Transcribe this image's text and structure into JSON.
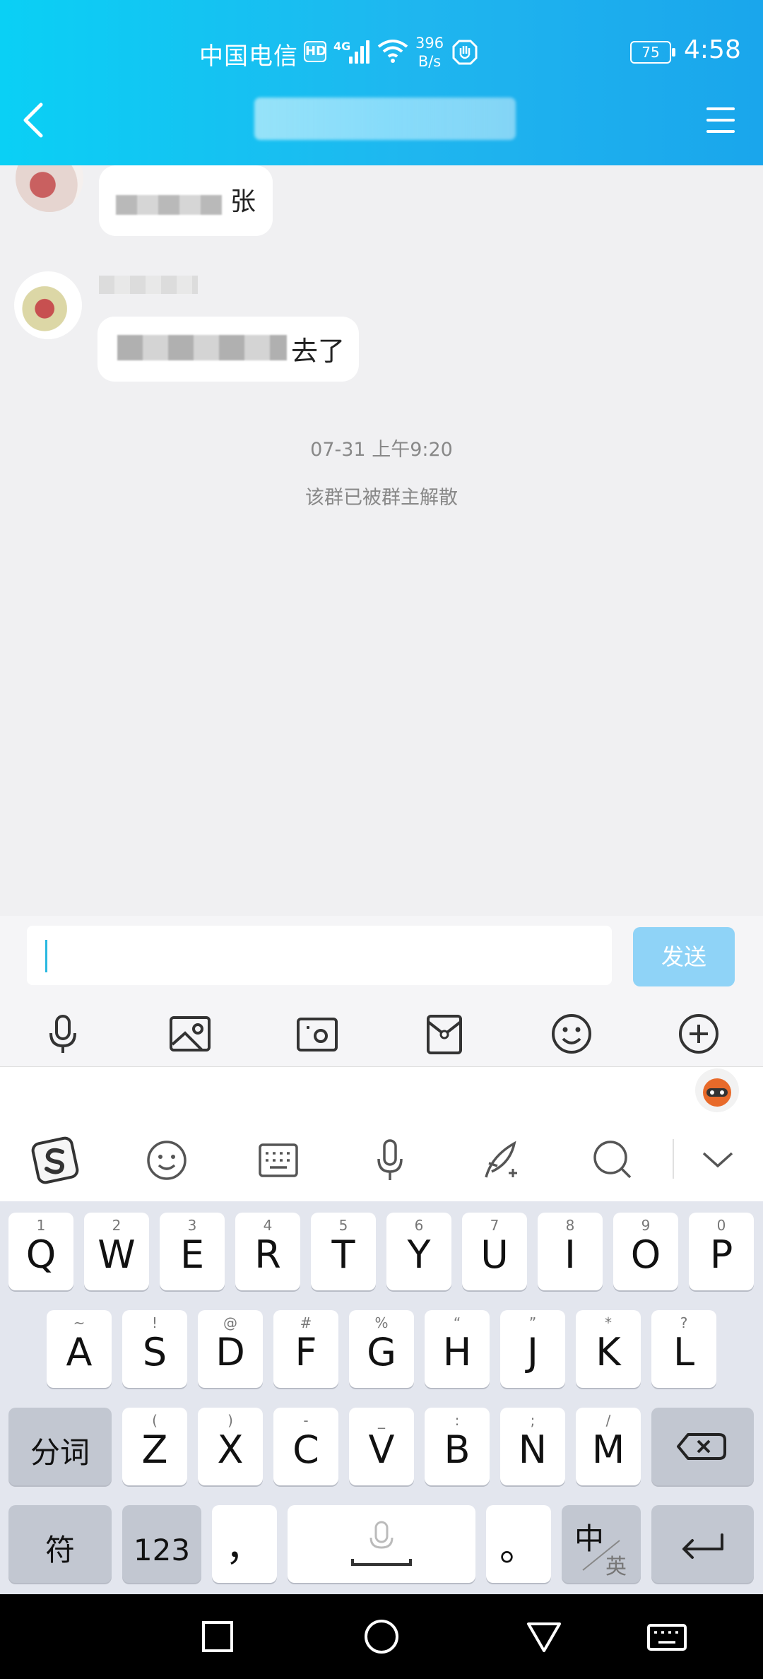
{
  "status_bar": {
    "carrier": "中国电信",
    "hd": "HD",
    "network": "4G",
    "speed_value": "396",
    "speed_unit": "B/s",
    "battery": "75",
    "time": "4:58"
  },
  "header": {
    "title": "(blurred)"
  },
  "chat": {
    "messages": [
      {
        "text": "(blurred)",
        "visible_char": "张"
      },
      {
        "sender": "(blurred)",
        "text": "(blurred)",
        "visible_char": "去了"
      }
    ],
    "timestamp": "07-31 上午9:20",
    "system_message": "该群已被群主解散"
  },
  "composer": {
    "input_value": "",
    "send_label": "发送",
    "tools": [
      "mic-icon",
      "image-icon",
      "camera-icon",
      "red-packet-icon",
      "emoji-icon",
      "plus-icon"
    ]
  },
  "ime_toolbar": {
    "icons": [
      "sogou-logo-icon",
      "emoji-icon",
      "keyboard-icon",
      "mic-icon",
      "handwriting-icon",
      "search-icon",
      "collapse-icon"
    ]
  },
  "keyboard": {
    "row1": [
      {
        "main": "Q",
        "sub": "1"
      },
      {
        "main": "W",
        "sub": "2"
      },
      {
        "main": "E",
        "sub": "3"
      },
      {
        "main": "R",
        "sub": "4"
      },
      {
        "main": "T",
        "sub": "5"
      },
      {
        "main": "Y",
        "sub": "6"
      },
      {
        "main": "U",
        "sub": "7"
      },
      {
        "main": "I",
        "sub": "8"
      },
      {
        "main": "O",
        "sub": "9"
      },
      {
        "main": "P",
        "sub": "0"
      }
    ],
    "row2": [
      {
        "main": "A",
        "sub": "~"
      },
      {
        "main": "S",
        "sub": "!"
      },
      {
        "main": "D",
        "sub": "@"
      },
      {
        "main": "F",
        "sub": "#"
      },
      {
        "main": "G",
        "sub": "%"
      },
      {
        "main": "H",
        "sub": "“"
      },
      {
        "main": "J",
        "sub": "”"
      },
      {
        "main": "K",
        "sub": "*"
      },
      {
        "main": "L",
        "sub": "?"
      }
    ],
    "row3": [
      {
        "main": "Z",
        "sub": "("
      },
      {
        "main": "X",
        "sub": ")"
      },
      {
        "main": "C",
        "sub": "-"
      },
      {
        "main": "V",
        "sub": "_"
      },
      {
        "main": "B",
        "sub": ":"
      },
      {
        "main": "N",
        "sub": ";"
      },
      {
        "main": "M",
        "sub": "/"
      }
    ],
    "fenci": "分词",
    "fu": "符",
    "num": "123",
    "comma": "，",
    "period": "。",
    "lang_main": "中",
    "lang_sub": "英"
  },
  "colors": {
    "header_start": "#0ad0f5",
    "header_end": "#1aa6ec",
    "send_button": "#8fd3f7"
  }
}
